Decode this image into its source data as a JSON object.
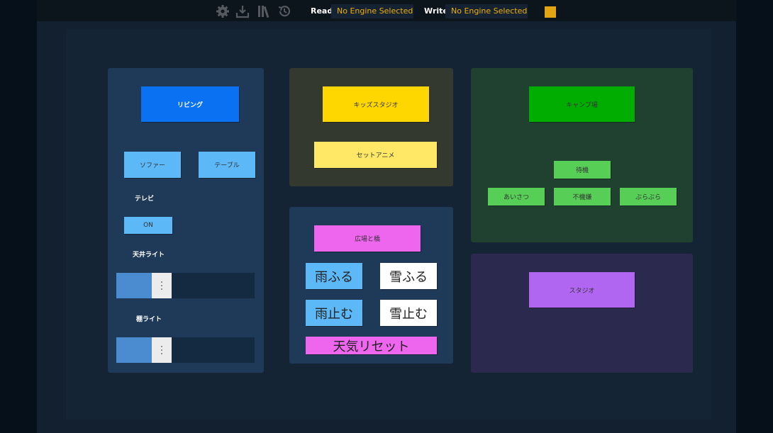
{
  "toolbar": {
    "icons": [
      "gear-icon",
      "download-icon",
      "library-icon",
      "history-icon"
    ],
    "read_label": "Read:",
    "read_value": "No Engine Selected",
    "write_label": "Write:",
    "write_value": "No Engine Selected",
    "accent": "#e3a612"
  },
  "living": {
    "title": "リビング",
    "sofa": "ソファー",
    "table": "テーブル",
    "tv_label": "テレビ",
    "tv_toggle": "ON",
    "ceiling_light_label": "天井ライト",
    "ceiling_light_level": 0.32,
    "shelf_light_label": "棚ライト",
    "shelf_light_level": 0.32
  },
  "kids": {
    "title": "キッズスタジオ",
    "anime": "セットアニメ"
  },
  "camp": {
    "title": "キャンプ場",
    "standby": "待機",
    "greet": "あいさつ",
    "moody": "不機嫌",
    "wander": "ぶらぶら"
  },
  "plaza": {
    "title": "広場と橋",
    "rain_on": "雨ふる",
    "snow_on": "雪ふる",
    "rain_off": "雨止む",
    "snow_off": "雪止む",
    "reset": "天気リセット"
  },
  "studio": {
    "title": "スタジオ"
  },
  "colors": {
    "living_panel": "#1f3a58",
    "kids_panel": "#33392f",
    "camp_panel": "#20412f",
    "plaza_panel": "#1f3a58",
    "studio_panel": "#2b2a4e",
    "blue": "#0a72f2",
    "light_blue": "#5db8f7",
    "yellow": "#ffd700",
    "light_yellow": "#ffe866",
    "green": "#00ad00",
    "light_green": "#57cf57",
    "pink": "#ee66ee",
    "purple": "#b066f0"
  }
}
